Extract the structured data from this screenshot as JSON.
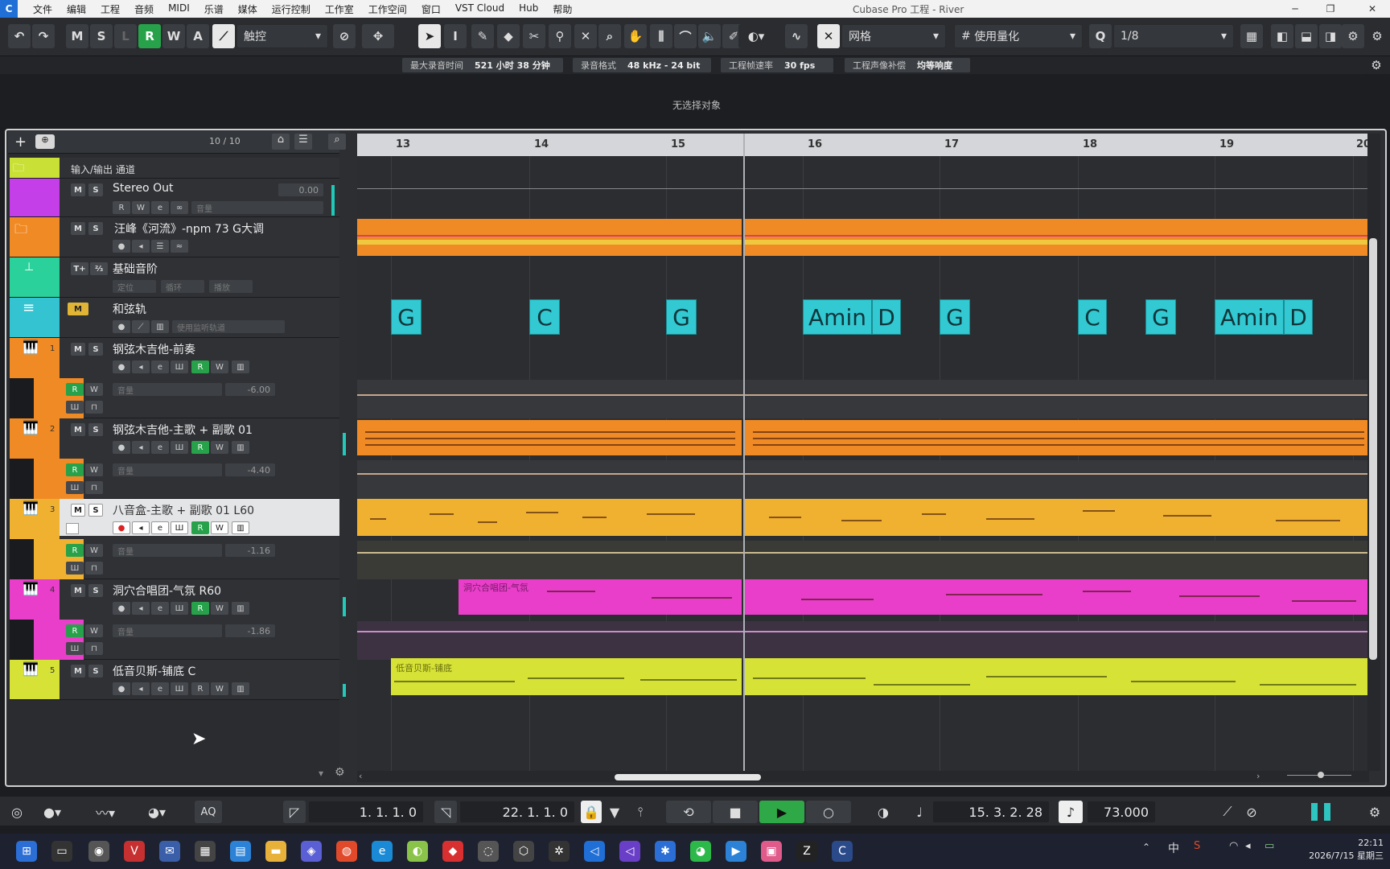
{
  "app": {
    "title": "Cubase Pro 工程 - River",
    "menu": [
      "文件",
      "编辑",
      "工程",
      "音频",
      "MIDI",
      "乐谱",
      "媒体",
      "运行控制",
      "工作室",
      "工作空间",
      "窗口",
      "VST Cloud",
      "Hub",
      "帮助"
    ]
  },
  "toolbar": {
    "undo": "↶",
    "redo": "↷",
    "mode_buttons": [
      "M",
      "S",
      "L",
      "R",
      "W",
      "A"
    ],
    "automation_mode": "触控",
    "grid_type": "网格",
    "quantize_type": "使用量化",
    "quantize_value": "1/8"
  },
  "info": {
    "max_rec_label": "最大录音时间",
    "max_rec_value": "521 小时 38 分钟",
    "rec_format_label": "录音格式",
    "rec_format_value": "48 kHz - 24 bit",
    "frame_rate_label": "工程帧速率",
    "frame_rate_value": "30 fps",
    "pan_label": "工程声像补偿",
    "pan_value": "均等响度"
  },
  "status": {
    "selection": "无选择对象"
  },
  "tracklist": {
    "count": "10 / 10",
    "io_label": "输入/输出 通道",
    "tracks": [
      {
        "name": "Stereo Out",
        "value": "0.00",
        "color": "#c43fe8"
      },
      {
        "name": "汪峰《河流》-npm 73 G大调",
        "color": "#f08a24"
      },
      {
        "name": "基础音阶",
        "color": "#2bd19a",
        "sub1": "定位",
        "sub2": "循环",
        "sub3": "播放"
      },
      {
        "name": "和弦轨",
        "color": "#34c3d0",
        "sub": "使用监听轨道"
      },
      {
        "name": "钢弦木吉他-前奏",
        "num": "1",
        "color": "#f08a24",
        "vol": "-6.00"
      },
      {
        "name": "钢弦木吉他-主歌 + 副歌 01",
        "num": "2",
        "color": "#f08a24",
        "vol": "-4.40"
      },
      {
        "name": "八音盒-主歌 + 副歌 01 L60",
        "num": "3",
        "color": "#f0b030",
        "vol": "-1.16"
      },
      {
        "name": "洞穴合唱团-气氛 R60",
        "num": "4",
        "color": "#e83ec9",
        "vol": "-1.86"
      },
      {
        "name": "低音贝斯-铺底 C",
        "num": "5",
        "color": "#d6e236"
      }
    ],
    "fader_label": "音量"
  },
  "ruler": {
    "bars": [
      "13",
      "14",
      "15",
      "16",
      "17",
      "18",
      "19",
      "20"
    ]
  },
  "chords": [
    "G",
    "C",
    "G",
    "Amin",
    "D",
    "G",
    "C",
    "G",
    "Amin",
    "D"
  ],
  "parts": {
    "choir_label": "洞穴合唱团-气氛",
    "bass_label": "低音贝斯-铺底"
  },
  "transport": {
    "left_locator": "1. 1. 1.   0",
    "right_locator": "22. 1. 1.   0",
    "position": "15. 3. 2. 28",
    "tempo": "73.000",
    "aq": "AQ"
  },
  "clock": {
    "time": "22:11",
    "date": "2026/7/15 星期三"
  },
  "taskbar_ime": "中"
}
